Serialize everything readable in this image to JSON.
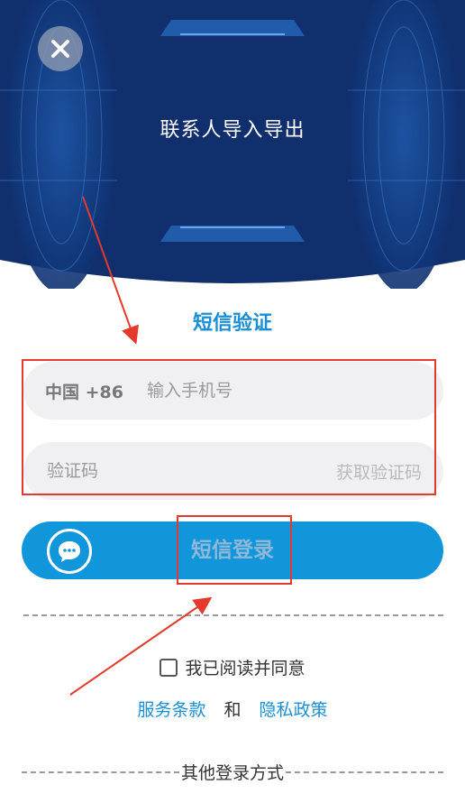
{
  "header": {
    "title": "联系人导入导出",
    "close_icon": "close-icon"
  },
  "form": {
    "section_title": "短信验证",
    "country_code": "中国 +86",
    "phone_placeholder": "输入手机号",
    "code_placeholder": "验证码",
    "get_code_label": "获取验证码"
  },
  "login": {
    "button_label": "短信登录",
    "icon": "chat-bubble-icon"
  },
  "agreement": {
    "checkbox_label": "我已阅读并同意",
    "terms_link": "服务条款",
    "and_text": "和",
    "privacy_link": "隐私政策"
  },
  "other_login": {
    "label": "其他登录方式"
  },
  "colors": {
    "header_bg": "#0f2f6b",
    "accent": "#1296db",
    "annotation_red": "#e43a2c"
  }
}
